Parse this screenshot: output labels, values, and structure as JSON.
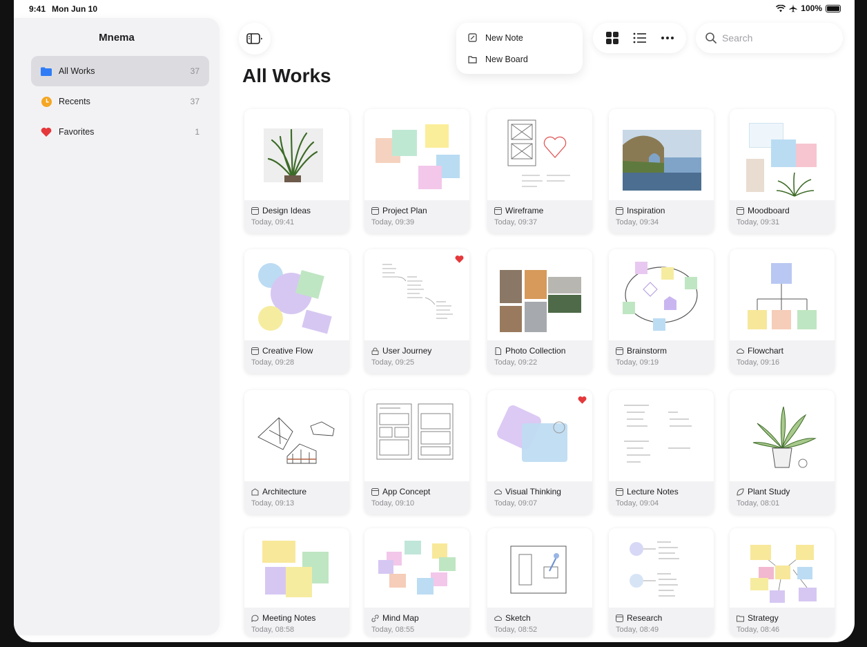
{
  "status": {
    "time": "9:41",
    "date": "Mon Jun 10",
    "battery": "100%"
  },
  "sidebar": {
    "title": "Mnema",
    "items": [
      {
        "label": "All Works",
        "count": "37",
        "icon": "folder-icon",
        "color": "#2f7cf6"
      },
      {
        "label": "Recents",
        "count": "37",
        "icon": "clock-icon",
        "color": "#f5a623"
      },
      {
        "label": "Favorites",
        "count": "1",
        "icon": "heart-icon",
        "color": "#e5383b"
      }
    ]
  },
  "menu": {
    "new_note": "New Note",
    "new_board": "New Board"
  },
  "search": {
    "placeholder": "Search"
  },
  "page_title": "All Works",
  "cards": [
    {
      "name": "Design Ideas",
      "time": "Today, 09:41"
    },
    {
      "name": "Project Plan",
      "time": "Today, 09:39"
    },
    {
      "name": "Wireframe",
      "time": "Today, 09:37"
    },
    {
      "name": "Inspiration",
      "time": "Today, 09:34"
    },
    {
      "name": "Moodboard",
      "time": "Today, 09:31"
    },
    {
      "name": "Creative Flow",
      "time": "Today, 09:28"
    },
    {
      "name": "User Journey",
      "time": "Today, 09:25",
      "favorite": true
    },
    {
      "name": "Photo Collection",
      "time": "Today, 09:22"
    },
    {
      "name": "Brainstorm",
      "time": "Today, 09:19"
    },
    {
      "name": "Flowchart",
      "time": "Today, 09:16"
    },
    {
      "name": "Architecture",
      "time": "Today, 09:13"
    },
    {
      "name": "App Concept",
      "time": "Today, 09:10"
    },
    {
      "name": "Visual Thinking",
      "time": "Today, 09:07",
      "favorite": true
    },
    {
      "name": "Lecture Notes",
      "time": "Today, 09:04"
    },
    {
      "name": "Plant Study",
      "time": "Today, 08:01"
    },
    {
      "name": "Meeting Notes",
      "time": "Today, 08:58"
    },
    {
      "name": "Mind Map",
      "time": "Today, 08:55"
    },
    {
      "name": "Sketch",
      "time": "Today, 08:52"
    },
    {
      "name": "Research",
      "time": "Today, 08:49"
    },
    {
      "name": "Strategy",
      "time": "Today, 08:46"
    }
  ]
}
